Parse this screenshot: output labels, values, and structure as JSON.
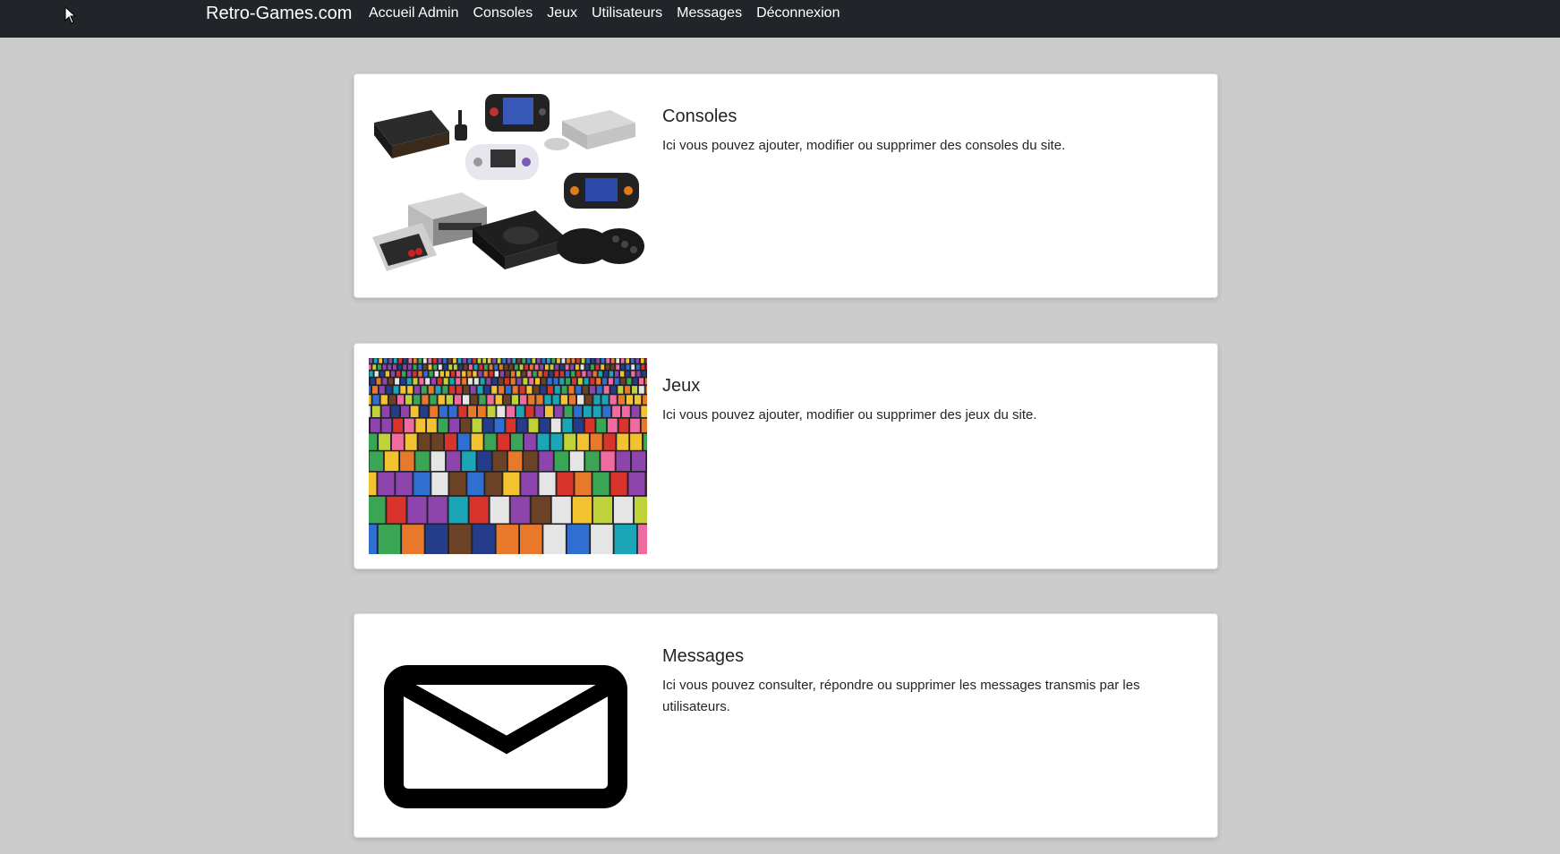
{
  "navbar": {
    "brand": "Retro-Games.com",
    "links": [
      "Accueil Admin",
      "Consoles",
      "Jeux",
      "Utilisateurs",
      "Messages",
      "Déconnexion"
    ]
  },
  "cards": [
    {
      "title": "Consoles",
      "text": "Ici vous pouvez ajouter, modifier ou supprimer des consoles du site.",
      "image": "retro-consoles-photo"
    },
    {
      "title": "Jeux",
      "text": "Ici vous pouvez ajouter, modifier ou supprimer des jeux du site.",
      "image": "game-cartridges-photo"
    },
    {
      "title": "Messages",
      "text": "Ici vous pouvez consulter, répondre ou supprimer les messages transmis par les utilisateurs.",
      "image": "envelope-icon"
    }
  ],
  "colors": {
    "navbar_bg": "#212529",
    "page_bg": "#cccccc",
    "card_bg": "#ffffff"
  }
}
